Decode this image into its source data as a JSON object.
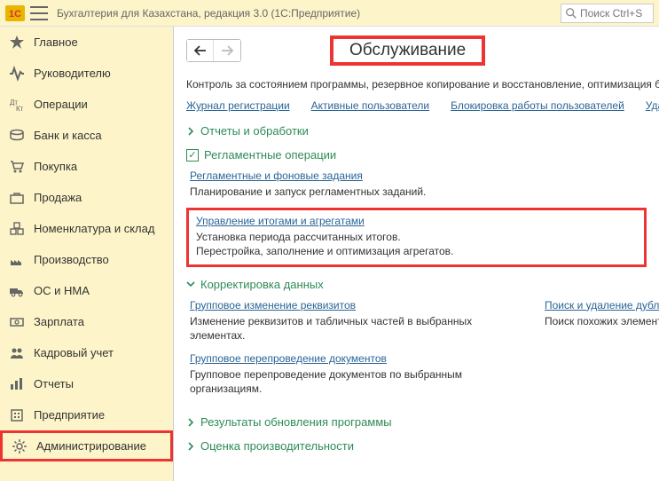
{
  "app": {
    "title": "Бухгалтерия для Казахстана, редакция 3.0  (1С:Предприятие)",
    "search_placeholder": "Поиск Ctrl+Shi"
  },
  "sidebar": {
    "items": [
      {
        "label": "Главное"
      },
      {
        "label": "Руководителю"
      },
      {
        "label": "Операции"
      },
      {
        "label": "Банк и касса"
      },
      {
        "label": "Покупка"
      },
      {
        "label": "Продажа"
      },
      {
        "label": "Номенклатура и склад"
      },
      {
        "label": "Производство"
      },
      {
        "label": "ОС и НМА"
      },
      {
        "label": "Зарплата"
      },
      {
        "label": "Кадровый учет"
      },
      {
        "label": "Отчеты"
      },
      {
        "label": "Предприятие"
      },
      {
        "label": "Администрирование"
      }
    ]
  },
  "content": {
    "title": "Обслуживание",
    "description": "Контроль за состоянием программы, резервное копирование и восстановление, оптимизация быстрод",
    "tabs": [
      "Журнал регистрации",
      "Активные пользователи",
      "Блокировка работы пользователей",
      "Удаление помече"
    ],
    "sections": {
      "reports": "Отчеты и обработки",
      "scheduled": {
        "title": "Регламентные операции",
        "block1_link": "Регламентные и фоновые задания",
        "block1_desc": "Планирование и запуск регламентных заданий.",
        "block2_link": "Управление итогами и агрегатами",
        "block2_desc1": "Установка периода рассчитанных итогов.",
        "block2_desc2": "Перестройка, заполнение и оптимизация агрегатов."
      },
      "correction": {
        "title": "Корректировка данных",
        "left1_link": "Групповое изменение реквизитов",
        "left1_desc": "Изменение реквизитов и табличных частей в выбранных элементах.",
        "left2_link": "Групповое перепроведение документов",
        "left2_desc": "Групповое перепроведение документов по выбранным организациям.",
        "right1_link": "Поиск и удаление дублей",
        "right1_desc": "Поиск похожих элементов по зад"
      },
      "update_results": "Результаты обновления программы",
      "performance": "Оценка производительности"
    }
  }
}
